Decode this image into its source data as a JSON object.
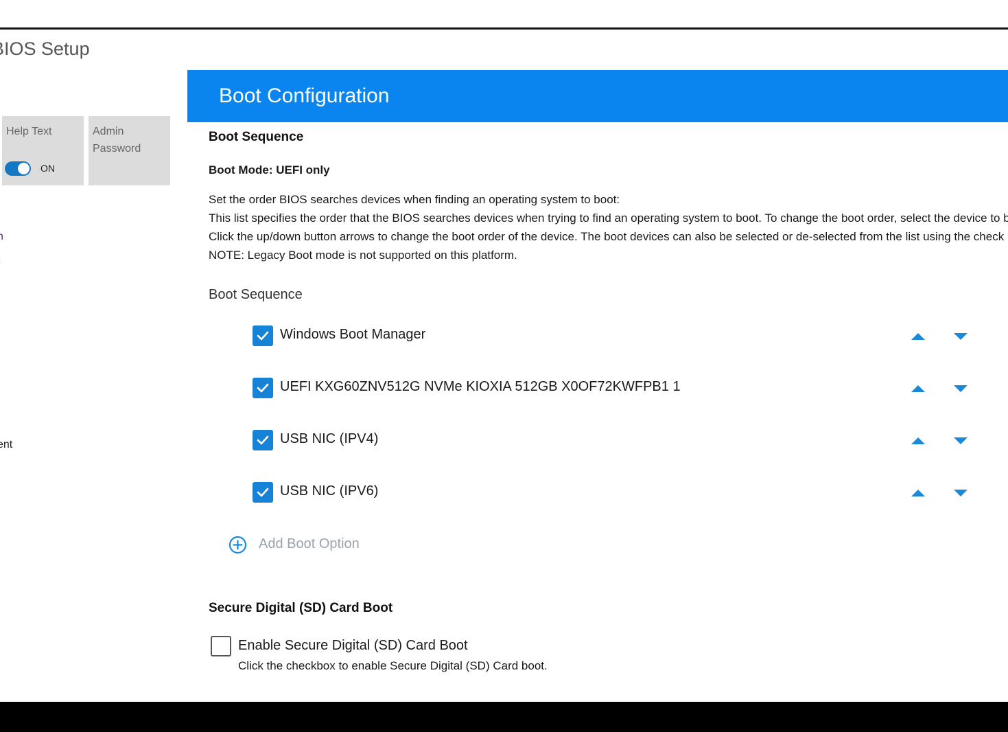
{
  "app": {
    "title": "BIOS Setup"
  },
  "quick_settings": {
    "help_text": {
      "label": "Help Text",
      "toggle_state": "ON"
    },
    "admin_password": {
      "label": "Admin Password"
    }
  },
  "sidebar_fragments": [
    "n",
    "t",
    "ent",
    "."
  ],
  "header": {
    "title": "Boot Configuration"
  },
  "boot_sequence": {
    "heading": "Boot Sequence",
    "boot_mode": "Boot Mode: UEFI only",
    "description": [
      "Set the order BIOS searches devices when finding an operating system to boot:",
      "This list specifies the order that the BIOS searches devices when trying to find an operating system to boot.  To change the boot order, select the device to be cl",
      "Click the up/down button arrows to change the boot order of the device.  The boot devices can also be selected or de-selected from the list using the check box",
      "NOTE: Legacy Boot mode is not supported on this platform."
    ],
    "list_label": "Boot Sequence",
    "items": [
      {
        "label": "Windows Boot Manager",
        "checked": true
      },
      {
        "label": "UEFI KXG60ZNV512G NVMe KIOXIA 512GB X0OF72KWFPB1 1",
        "checked": true
      },
      {
        "label": "USB NIC (IPV4)",
        "checked": true
      },
      {
        "label": "USB NIC (IPV6)",
        "checked": true
      }
    ],
    "add_option_label": "Add Boot Option"
  },
  "sd_card_boot": {
    "heading": "Secure Digital (SD) Card Boot",
    "checkbox_label": "Enable Secure Digital (SD) Card Boot",
    "checked": false,
    "help": "Click the checkbox to enable Secure Digital (SD) Card boot."
  },
  "icons": {
    "checkbox_check": "check-icon",
    "move_up": "arrow-up-icon",
    "move_down": "arrow-down-icon",
    "add": "plus-circle-icon"
  },
  "colors": {
    "header": "#0a85f0",
    "checkbox": "#1783d6",
    "arrow": "#1a8ad8",
    "toggle": "#1479c4"
  }
}
